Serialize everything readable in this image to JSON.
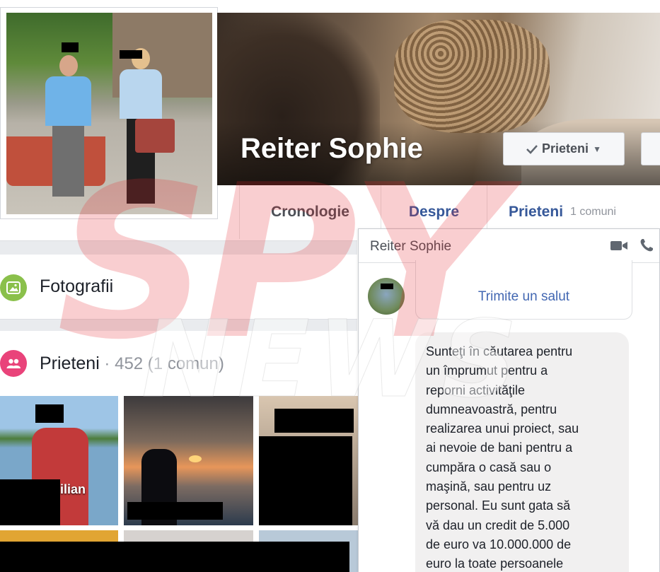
{
  "profile": {
    "name": "Reiter Sophie",
    "friends_button_label": "Prieteni"
  },
  "tabs": {
    "cronologie": "Cronologie",
    "despre": "Despre",
    "prieteni": "Prieteni",
    "prieteni_count": "1 comuni"
  },
  "photos": {
    "title": "Fotografii"
  },
  "friends": {
    "title": "Prieteni",
    "meta": " · 452 (1 comun)",
    "tile_label": "ilian"
  },
  "chat": {
    "title": "Reiter Sophie",
    "greet_link": "Trimite un salut",
    "message": "Sunteţi în căutarea pentru\nun împrumut pentru a\nreporni activităţile\ndumneavoastră, pentru\nrealizarea unui proiect, sau\nai nevoie de bani pentru a\ncumpăra o casă sau o\nmaşină, sau pentru uz\npersonal. Eu sunt gata să\nvă dau un credit de 5.000\nde euro va 10.000.000 de\neuro la toate persoanele"
  },
  "watermark": {
    "text": "SPYNEWS"
  },
  "colors": {
    "link_blue": "#365899",
    "greet_blue": "#4267b2",
    "photos_green": "#8ac04b",
    "friends_pink": "#e9437a",
    "watermark_red": "#e8262c"
  },
  "icons": [
    "check-icon",
    "caret-down-icon",
    "photos-icon",
    "friends-icon",
    "video-camera-icon",
    "phone-icon"
  ]
}
